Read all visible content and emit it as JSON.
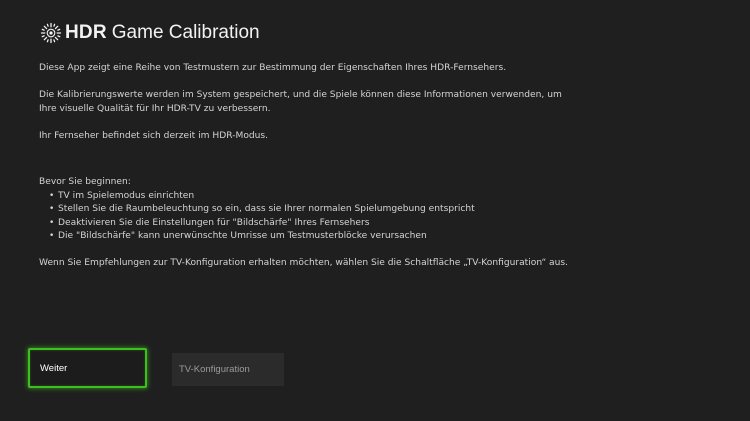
{
  "header": {
    "logo_icon": "hdr-sun-icon",
    "brand": "HDR",
    "title": "Game Calibration"
  },
  "intro": {
    "p1": "Diese App zeigt eine Reihe von Testmustern zur Bestimmung der Eigenschaften Ihres HDR-Fernsehers.",
    "p2_line1": "Die Kalibrierungswerte werden im System gespeichert, und die Spiele können diese Informationen verwenden, um",
    "p2_line2": "Ihre visuelle Qualität für Ihr HDR-TV zu verbessern.",
    "p3": "Ihr Fernseher befindet sich derzeit im HDR-Modus."
  },
  "before": {
    "heading": "Bevor Sie beginnen:",
    "bullet_char": "•",
    "items": [
      "TV im Spielemodus einrichten",
      "Stellen Sie die Raumbeleuchtung so ein, dass sie Ihrer normalen Spielumgebung entspricht",
      "Deaktivieren Sie die Einstellungen für \"Bildschärfe\" Ihres Fernsehers",
      "Die \"Bildschärfe\" kann unerwünschte Umrisse um Testmusterblöcke verursachen"
    ]
  },
  "tv_hint": "Wenn Sie Empfehlungen zur TV-Konfiguration erhalten möchten, wählen Sie die Schaltfläche „TV-Konfiguration“ aus.",
  "buttons": {
    "continue_label": "Weiter",
    "tv_config_label": "TV-Konfiguration"
  },
  "colors": {
    "background": "#1f1f1f",
    "focus_accent": "#3fbf1e",
    "text": "#d4d4d4"
  }
}
